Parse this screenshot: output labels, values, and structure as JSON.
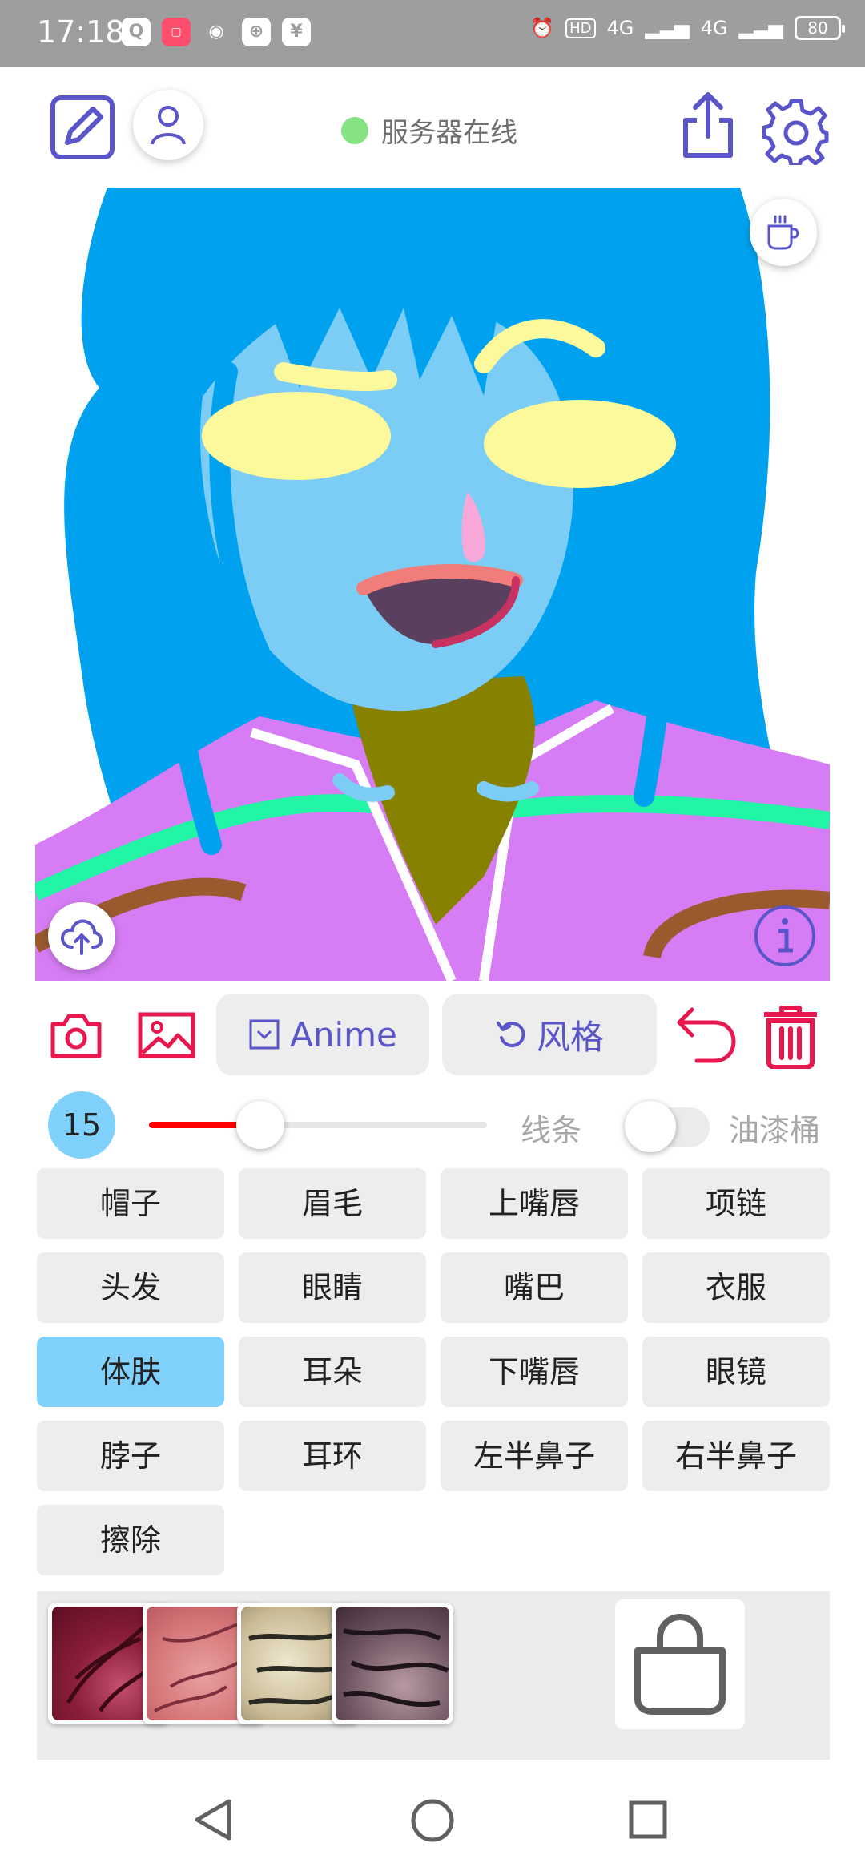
{
  "status_bar": {
    "time": "17:18",
    "app_icons": [
      "qq-icon",
      "xiaohongshu-icon",
      "weibo-icon",
      "browser-icon",
      "alipay-icon"
    ],
    "hd_label": "HD",
    "network1": "4G",
    "network2": "4G",
    "battery": "80"
  },
  "header": {
    "server_status": "服务器在线",
    "server_status_color": "#86e383"
  },
  "toolbar": {
    "anime_label": "Anime",
    "style_label": "风格"
  },
  "brush": {
    "size": "15",
    "size_fraction": 0.33,
    "line_label": "线条",
    "bucket_label": "油漆桶",
    "bucket_enabled": false
  },
  "parts": [
    {
      "label": "帽子",
      "active": false
    },
    {
      "label": "眉毛",
      "active": false
    },
    {
      "label": "上嘴唇",
      "active": false
    },
    {
      "label": "项链",
      "active": false
    },
    {
      "label": "头发",
      "active": false
    },
    {
      "label": "眼睛",
      "active": false
    },
    {
      "label": "嘴巴",
      "active": false
    },
    {
      "label": "衣服",
      "active": false
    },
    {
      "label": "体肤",
      "active": true
    },
    {
      "label": "耳朵",
      "active": false
    },
    {
      "label": "下嘴唇",
      "active": false
    },
    {
      "label": "眼镜",
      "active": false
    },
    {
      "label": "脖子",
      "active": false
    },
    {
      "label": "耳环",
      "active": false
    },
    {
      "label": "左半鼻子",
      "active": false
    },
    {
      "label": "右半鼻子",
      "active": false
    },
    {
      "label": "擦除",
      "active": false
    }
  ],
  "colors": {
    "accent": "#5a55c8",
    "danger": "#e8174e",
    "selected": "#7fd0fb",
    "hair": "#00a2ef",
    "skin": "#7ccdf6",
    "eyes": "#fbf99b",
    "clothes": "#d67df5",
    "neck": "#868200",
    "stripe_green": "#22f5a5",
    "stripe_brown": "#9b5a2e"
  }
}
